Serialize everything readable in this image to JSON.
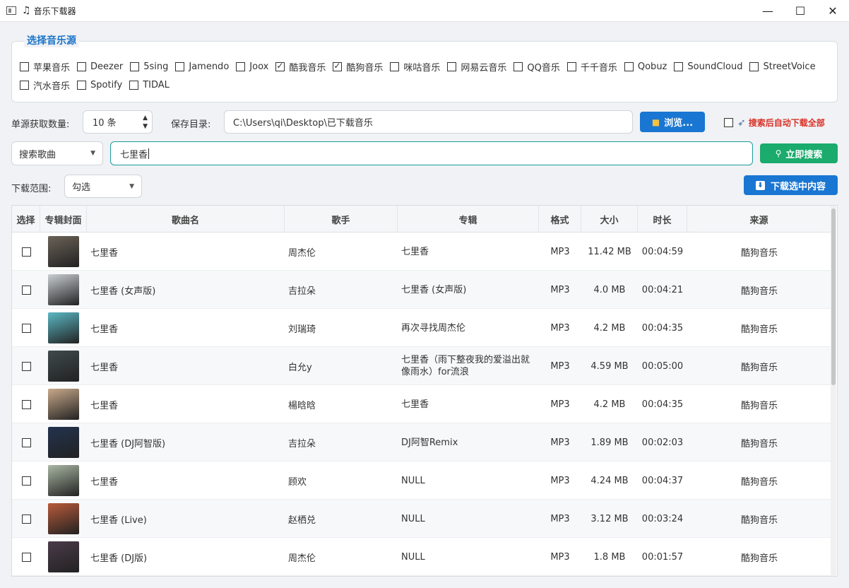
{
  "window": {
    "title": "音乐下载器",
    "minimize": "—",
    "maximize": "☐",
    "close": "✕"
  },
  "sources": {
    "title": "选择音乐源",
    "row1": [
      {
        "label": "苹果音乐",
        "checked": false
      },
      {
        "label": "Deezer",
        "checked": false
      },
      {
        "label": "5sing",
        "checked": false
      },
      {
        "label": "Jamendo",
        "checked": false
      },
      {
        "label": "Joox",
        "checked": false
      },
      {
        "label": "酷我音乐",
        "checked": true
      },
      {
        "label": "酷狗音乐",
        "checked": true
      },
      {
        "label": "咪咕音乐",
        "checked": false
      },
      {
        "label": "网易云音乐",
        "checked": false
      },
      {
        "label": "QQ音乐",
        "checked": false
      },
      {
        "label": "千千音乐",
        "checked": false
      },
      {
        "label": "Qobuz",
        "checked": false
      },
      {
        "label": "SoundCloud",
        "checked": false
      },
      {
        "label": "StreetVoice",
        "checked": false
      }
    ],
    "row2": [
      {
        "label": "汽水音乐",
        "checked": false
      },
      {
        "label": "Spotify",
        "checked": false
      },
      {
        "label": "TIDAL",
        "checked": false
      }
    ]
  },
  "controls": {
    "count_label": "单源获取数量:",
    "count_value": "10 条",
    "save_label": "保存目录:",
    "save_path": "C:\\Users\\qi\\Desktop\\已下载音乐",
    "browse_label": "浏览...",
    "auto_download_label": "搜索后自动下载全部",
    "auto_download_checked": false,
    "search_type": "搜索歌曲",
    "search_query": "七里香",
    "search_button": "立即搜索",
    "range_label": "下载范围:",
    "range_value": "勾选",
    "download_selected": "下载选中内容"
  },
  "table": {
    "headers": [
      "选择",
      "专辑封面",
      "歌曲名",
      "歌手",
      "专辑",
      "格式",
      "大小",
      "时长",
      "来源"
    ],
    "rows": [
      {
        "title": "七里香",
        "artist": "周杰伦",
        "album": "七里香",
        "format": "MP3",
        "size": "11.42 MB",
        "duration": "00:04:59",
        "source": "酷狗音乐",
        "cover": "#6b6257"
      },
      {
        "title": "七里香 (女声版)",
        "artist": "吉拉朵",
        "album": "七里香 (女声版)",
        "format": "MP3",
        "size": "4.0 MB",
        "duration": "00:04:21",
        "source": "酷狗音乐",
        "cover": "#c9ced3"
      },
      {
        "title": "七里香",
        "artist": "刘瑞琦",
        "album": "再次寻找周杰伦",
        "format": "MP3",
        "size": "4.2 MB",
        "duration": "00:04:35",
        "source": "酷狗音乐",
        "cover": "#5ab8c4"
      },
      {
        "title": "七里香",
        "artist": "白允y",
        "album": "七里香（雨下整夜我的爱溢出就像雨水）for流浪",
        "format": "MP3",
        "size": "4.59 MB",
        "duration": "00:05:00",
        "source": "酷狗音乐",
        "cover": "#3f4a4c"
      },
      {
        "title": "七里香",
        "artist": "楊晗晗",
        "album": "七里香",
        "format": "MP3",
        "size": "4.2 MB",
        "duration": "00:04:35",
        "source": "酷狗音乐",
        "cover": "#c9a98a"
      },
      {
        "title": "七里香 (DJ阿智版)",
        "artist": "吉拉朵",
        "album": "DJ阿智Remix",
        "format": "MP3",
        "size": "1.89 MB",
        "duration": "00:02:03",
        "source": "酷狗音乐",
        "cover": "#22334f"
      },
      {
        "title": "七里香",
        "artist": "顾欢",
        "album": "NULL",
        "format": "MP3",
        "size": "4.24 MB",
        "duration": "00:04:37",
        "source": "酷狗音乐",
        "cover": "#a9b7a3"
      },
      {
        "title": "七里香 (Live)",
        "artist": "赵栖兑",
        "album": "NULL",
        "format": "MP3",
        "size": "3.12 MB",
        "duration": "00:03:24",
        "source": "酷狗音乐",
        "cover": "#b85a3a"
      },
      {
        "title": "七里香 (DJ版)",
        "artist": "周杰伦",
        "album": "NULL",
        "format": "MP3",
        "size": "1.8 MB",
        "duration": "00:01:57",
        "source": "酷狗音乐",
        "cover": "#4b3b4a"
      }
    ]
  }
}
